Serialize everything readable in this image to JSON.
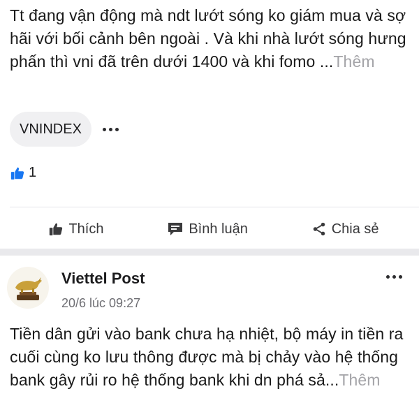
{
  "post1": {
    "text": "Tt đang vận động mà ndt lướt sóng ko giám mua và sợ hãi với bối cảnh bên ngoài . Và khi nhà lướt sóng hưng phấn thì vni đã trên dưới 1400 và khi fomo ...",
    "more_label": "Thêm",
    "tag": "VNINDEX",
    "tag_more_icon": "more-dots-icon",
    "like_count": "1",
    "actions": {
      "like_label": "Thích",
      "comment_label": "Bình luận",
      "share_label": "Chia sẻ"
    }
  },
  "post2": {
    "author": "Viettel Post",
    "time": "20/6 lúc 09:27",
    "avatar_icon": "golden-bull-logo",
    "text": "Tiền dân gửi vào bank chưa hạ nhiệt, bộ máy in tiền ra cuối cùng ko lưu thông được mà bị chảy vào hệ thống bank gây rủi ro hệ thống bank khi dn phá sả...",
    "more_label": "Thêm"
  },
  "colors": {
    "like_blue": "#1877f2",
    "muted_gray": "#a4a4a8",
    "chip_bg": "#f0f0f2",
    "gold": "#c9a03a"
  }
}
